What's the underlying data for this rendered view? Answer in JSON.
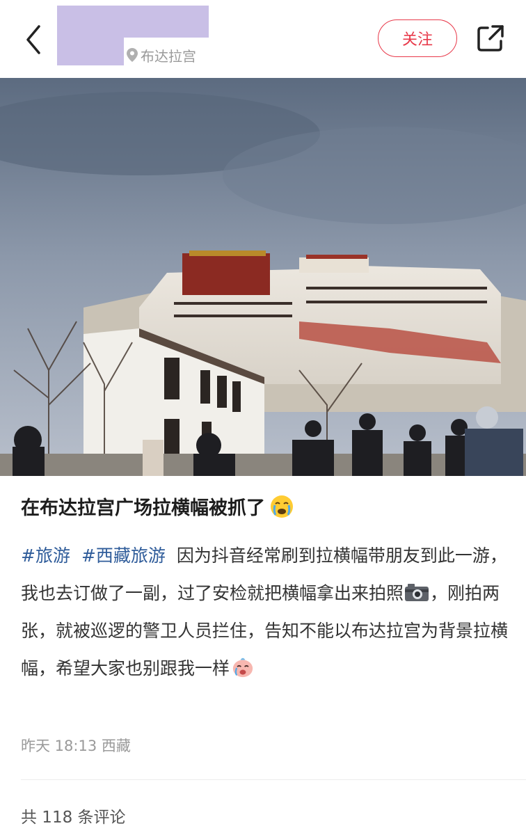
{
  "header": {
    "location": "布达拉宫",
    "follow_label": "关注"
  },
  "post": {
    "title": "在布达拉宫广场拉横幅被抓了",
    "tags": [
      "#旅游",
      "#西藏旅游"
    ],
    "body_part1": "因为抖音经常刷到拉横幅带朋友到此一游，我也去订做了一副，过了安检就把横幅拿出来拍照",
    "body_part2": "，刚拍两张，就被巡逻的警卫人员拦住，告知不能以布达拉宫为背景拉横幅，希望大家也别跟我一样",
    "meta": "昨天 18:13 西藏"
  },
  "comments": {
    "summary": "共 118 条评论"
  },
  "colors": {
    "accent": "#e8394a",
    "tag": "#2f5c9a",
    "redaction": "#c9bfe6"
  }
}
